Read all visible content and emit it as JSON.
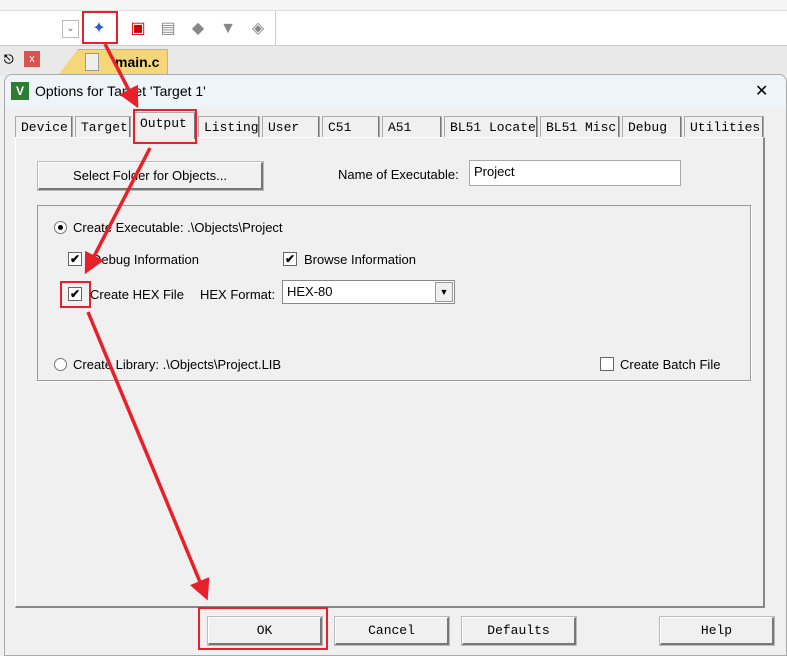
{
  "toolbar": {
    "icons": [
      "dropdown-icon",
      "options-wand-icon",
      "component-icon",
      "window-icon",
      "manage-icon",
      "funnel-icon",
      "pack-icon"
    ]
  },
  "editor": {
    "file_tab": "main.c"
  },
  "dialog": {
    "title": "Options for Target 'Target 1'",
    "close": "✕",
    "tabs": [
      "Device",
      "Target",
      "Output",
      "Listing",
      "User",
      "C51",
      "A51",
      "BL51 Locate",
      "BL51 Misc",
      "Debug",
      "Utilities"
    ],
    "selected_tab": "Output",
    "select_folder_button": "Select Folder for Objects...",
    "name_of_executable_label": "Name of Executable:",
    "name_of_executable_value": "Project",
    "create_executable_label": "Create Executable:  .\\Objects\\Project",
    "create_executable_selected": true,
    "debug_information_label": "Debug Information",
    "debug_information_checked": true,
    "browse_information_label": "Browse Information",
    "browse_information_checked": true,
    "create_hex_label": "Create HEX File",
    "create_hex_checked": true,
    "hex_format_label": "HEX Format:",
    "hex_format_value": "HEX-80",
    "create_library_label": "Create Library:  .\\Objects\\Project.LIB",
    "create_batch_label": "Create Batch File",
    "create_batch_checked": false,
    "buttons": {
      "ok": "OK",
      "cancel": "Cancel",
      "defaults": "Defaults",
      "help": "Help"
    },
    "check_glyph": "✔"
  },
  "annotation_color": "#e8202a"
}
